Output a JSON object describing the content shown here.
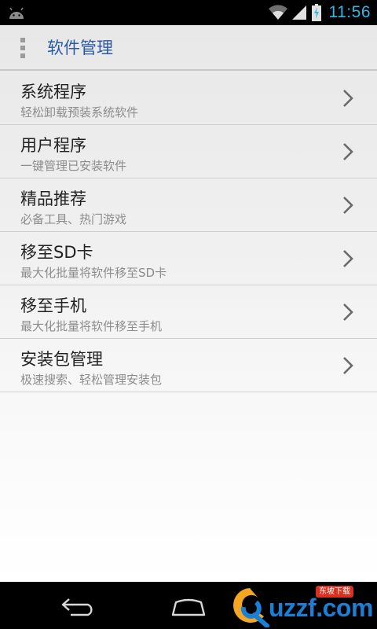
{
  "status_bar": {
    "time": "11:56",
    "icons": [
      "android-icon",
      "wifi-icon",
      "signal-icon",
      "battery-charging-icon"
    ]
  },
  "action_bar": {
    "title": "软件管理",
    "overflow_icon": "overflow-menu-icon"
  },
  "menu": {
    "items": [
      {
        "title": "系统程序",
        "subtitle": "轻松卸载预装系统软件"
      },
      {
        "title": "用户程序",
        "subtitle": "一键管理已安装软件"
      },
      {
        "title": "精品推荐",
        "subtitle": "必备工具、热门游戏"
      },
      {
        "title": "移至SD卡",
        "subtitle": "最大化批量将软件移至SD卡"
      },
      {
        "title": "移至手机",
        "subtitle": "最大化批量将软件移至手机"
      },
      {
        "title": "安装包管理",
        "subtitle": "极速搜索、轻松管理安装包"
      }
    ]
  },
  "nav_bar": {
    "icons": [
      "back-icon",
      "home-icon"
    ]
  },
  "watermark": {
    "text": "uzzf.com",
    "badge": "东坡下载"
  },
  "colors": {
    "title_blue": "#2a5aa6",
    "clock_blue": "#33b5e5",
    "watermark_blue": "#1a7fd6",
    "badge_red": "#d9301f"
  }
}
